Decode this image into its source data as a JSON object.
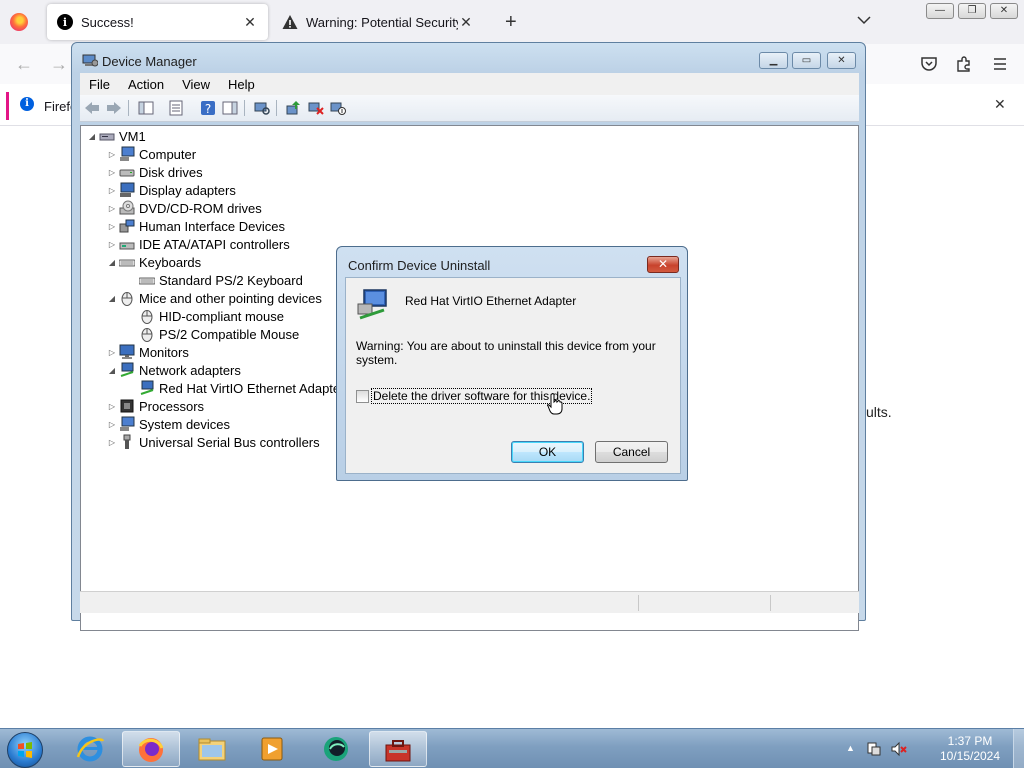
{
  "firefox": {
    "tabs": [
      {
        "title": "Success!",
        "icon": "info-icon"
      },
      {
        "title": "Warning: Potential Security Risk",
        "icon": "warning-icon"
      }
    ],
    "notification_text": "Firefo",
    "page_partial_text": "ults."
  },
  "device_manager": {
    "title": "Device Manager",
    "menu": [
      "File",
      "Action",
      "View",
      "Help"
    ],
    "tree": {
      "root": "VM1",
      "categories": [
        {
          "label": "Computer",
          "expanded": false,
          "icon": "computer-icon"
        },
        {
          "label": "Disk drives",
          "expanded": false,
          "icon": "disk-icon"
        },
        {
          "label": "Display adapters",
          "expanded": false,
          "icon": "display-icon"
        },
        {
          "label": "DVD/CD-ROM drives",
          "expanded": false,
          "icon": "dvd-icon"
        },
        {
          "label": "Human Interface Devices",
          "expanded": false,
          "icon": "hid-icon"
        },
        {
          "label": "IDE ATA/ATAPI controllers",
          "expanded": false,
          "icon": "ide-icon"
        },
        {
          "label": "Keyboards",
          "expanded": true,
          "icon": "keyboard-icon",
          "children": [
            "Standard PS/2 Keyboard"
          ]
        },
        {
          "label": "Mice and other pointing devices",
          "expanded": true,
          "icon": "mouse-icon",
          "children": [
            "HID-compliant mouse",
            "PS/2 Compatible Mouse"
          ]
        },
        {
          "label": "Monitors",
          "expanded": false,
          "icon": "monitor-icon"
        },
        {
          "label": "Network adapters",
          "expanded": true,
          "icon": "network-icon",
          "children": [
            "Red Hat VirtIO Ethernet Adapter"
          ]
        },
        {
          "label": "Processors",
          "expanded": false,
          "icon": "processor-icon"
        },
        {
          "label": "System devices",
          "expanded": false,
          "icon": "system-icon"
        },
        {
          "label": "Universal Serial Bus controllers",
          "expanded": false,
          "icon": "usb-icon"
        }
      ]
    }
  },
  "dialog": {
    "title": "Confirm Device Uninstall",
    "device_name": "Red Hat VirtIO Ethernet Adapter",
    "warning": "Warning: You are about to uninstall this device from your system.",
    "checkbox_label": "Delete the driver software for this device.",
    "checkbox_checked": false,
    "ok_label": "OK",
    "cancel_label": "Cancel"
  },
  "taskbar": {
    "time": "1:37 PM",
    "date": "10/15/2024"
  },
  "colors": {
    "aero_blue": "#bcd1e6",
    "close_red": "#c8432d",
    "taskbar": "#7f9fc0"
  }
}
